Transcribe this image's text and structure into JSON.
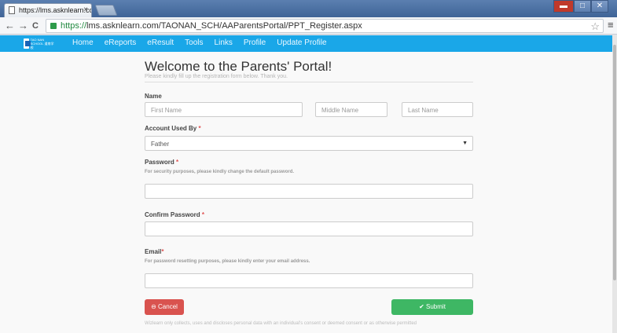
{
  "browser": {
    "tab_title": "https://lms.asknlearn.com/",
    "tab_close": "×",
    "url_protocol": "https://",
    "url_rest": "lms.asknlearn.com/TAONAN_SCH/AAParentsPortal/PPT_Register.aspx",
    "back": "←",
    "forward": "→",
    "reload": "C",
    "star": "☆",
    "menu": "≡"
  },
  "navbar": {
    "logo_text": "TAO NAN SCHOOL 道南学校",
    "items": [
      "Home",
      "eReports",
      "eResult",
      "Tools",
      "Links",
      "Profile",
      "Update Profile"
    ]
  },
  "form": {
    "title": "Welcome to the Parents' Portal!",
    "subtitle": "Please kindly fill up the registration form below. Thank you.",
    "name": {
      "label": "Name",
      "first_placeholder": "First Name",
      "middle_placeholder": "Middle Name",
      "last_placeholder": "Last Name"
    },
    "account": {
      "label": "Account Used By",
      "required": "*",
      "value": "Father",
      "caret": "▼"
    },
    "password": {
      "label": "Password",
      "required": "*",
      "help": "For security purposes, please kindly change the default password."
    },
    "confirm": {
      "label": "Confirm Password",
      "required": "*"
    },
    "email": {
      "label": "Email",
      "required": "*",
      "help": "For password resetting purposes, please kindly enter your email address."
    },
    "cancel_label": "Cancel",
    "submit_label": "Submit",
    "footnote": "Wizlearn only collects, uses and discloses personal data with an individual's consent or deemed consent or as otherwise permitted"
  },
  "colors": {
    "navbar": "#1aa7e8",
    "cancel": "#d9534f",
    "submit": "#3eb764"
  }
}
